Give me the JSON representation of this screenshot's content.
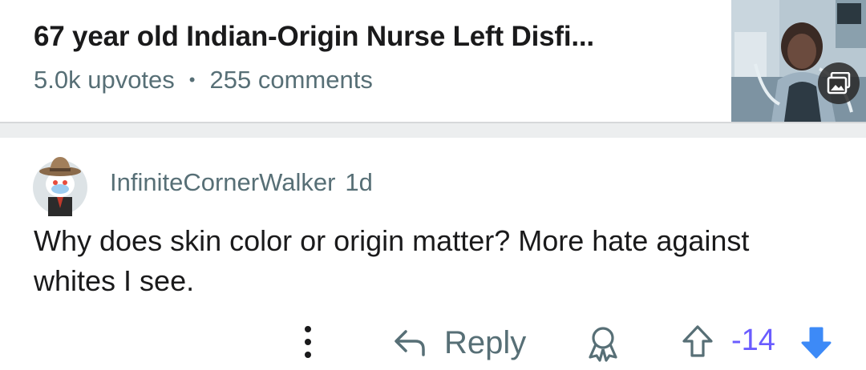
{
  "post": {
    "title": "67 year old Indian-Origin Nurse Left Disfi...",
    "upvotes": "5.0k upvotes",
    "separator_dot": "•",
    "comments": "255 comments",
    "thumbnail_icon": "gallery-icon"
  },
  "comment": {
    "author": "InfiniteCornerWalker",
    "time": "1d",
    "body": "Why does skin color or origin matter? More hate against whites I see.",
    "actions": {
      "more_icon": "vertical-dots-icon",
      "reply_icon": "reply-arrow-icon",
      "reply_label": "Reply",
      "award_icon": "award-icon",
      "upvote_icon": "upvote-arrow-icon",
      "vote_count": "-14",
      "downvote_icon": "downvote-arrow-icon"
    }
  },
  "colors": {
    "text_primary": "#1a1a1b",
    "text_secondary": "#576f76",
    "downvote_active": "#6a5cff",
    "downvote_arrow": "#3d8af7",
    "separator": "#eceeef"
  }
}
